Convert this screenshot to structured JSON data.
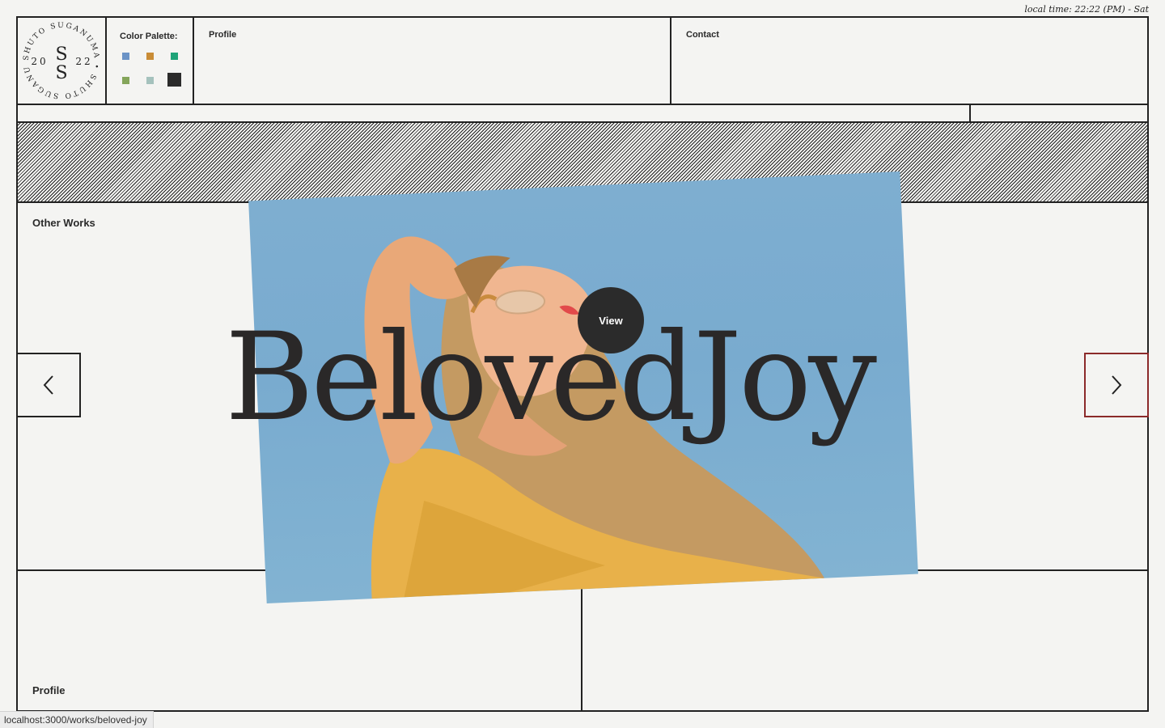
{
  "header": {
    "local_time": "local time: 22:22 (PM) - Sat",
    "logo": {
      "letter": "S",
      "year_left": "20",
      "year_right": "22",
      "ring_text": "SHUTO SUGANUMA • SHUTO SUGANUMA •"
    },
    "palette_label": "Color Palette:",
    "palette_colors": [
      "#6b93c6",
      "#c98c36",
      "#1fa378",
      "#84a55a",
      "#a5c2bd",
      "#2b2b2b"
    ],
    "profile_label": "Profile",
    "contact_label": "Contact"
  },
  "main": {
    "section_label": "Other Works",
    "work_title": "BelovedJoy",
    "view_label": "View",
    "prev_icon": "chevron-left-icon",
    "next_icon": "chevron-right-icon"
  },
  "footer": {
    "profile_label": "Profile"
  },
  "status_bar": {
    "url": "localhost:3000/works/beloved-joy"
  }
}
